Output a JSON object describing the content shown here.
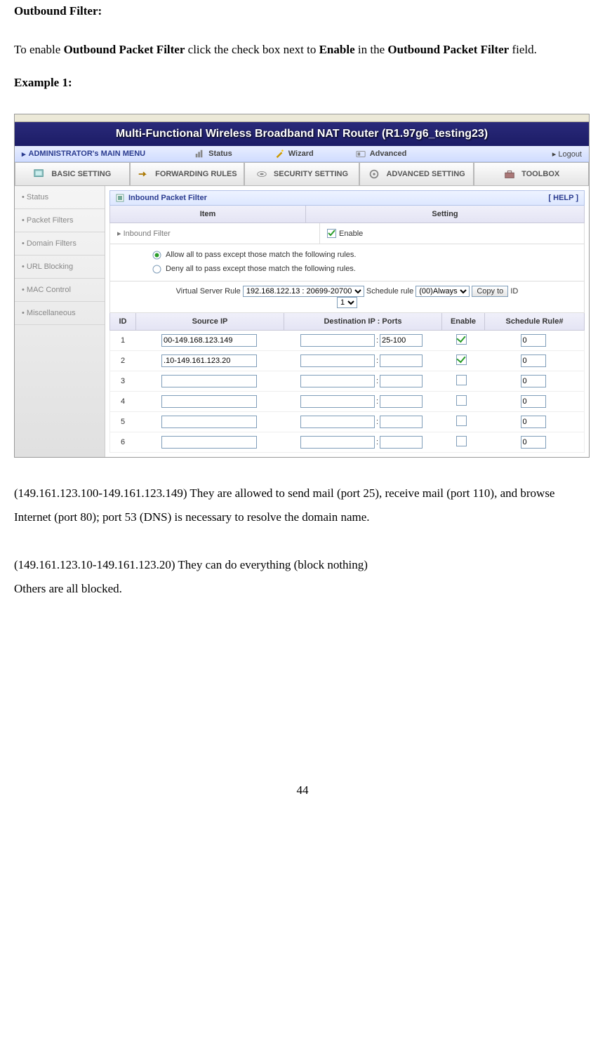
{
  "doc": {
    "heading": "Outbound Filter:",
    "body1_pre": "To enable ",
    "body1_b1": "Outbound Packet Filter",
    "body1_mid": " click the check box next to ",
    "body1_b2": "Enable",
    "body1_mid2": " in the ",
    "body1_b3": "Outbound Packet Filter",
    "body1_end": " field.",
    "example": "Example 1:",
    "para1": "(149.161.123.100-149.161.123.149) They are allowed to send mail (port 25), receive mail (port 110), and browse Internet (port 80); port 53 (DNS) is necessary to resolve the domain name.",
    "para2": "(149.161.123.10-149.161.123.20) They can do everything (block nothing)",
    "para3": "Others are all blocked.",
    "pagenum": "44"
  },
  "router": {
    "title": "Multi-Functional Wireless Broadband NAT Router (R1.97g6_testing23)",
    "admin_label": "ADMINISTRATOR's MAIN MENU",
    "nav_status": "Status",
    "nav_wizard": "Wizard",
    "nav_advanced": "Advanced",
    "logout": "Logout",
    "tabs": {
      "basic": "BASIC SETTING",
      "forwarding": "FORWARDING RULES",
      "security": "SECURITY SETTING",
      "advanced": "ADVANCED SETTING",
      "toolbox": "TOOLBOX"
    },
    "sidebar": [
      "Status",
      "Packet Filters",
      "Domain Filters",
      "URL Blocking",
      "MAC Control",
      "Miscellaneous"
    ],
    "panel_title": "Inbound Packet Filter",
    "help": "[ HELP ]",
    "col_item": "Item",
    "col_setting": "Setting",
    "inbound_filter_label": "Inbound Filter",
    "enable_label": "Enable",
    "rule_allow": "Allow all to pass except those match the following rules.",
    "rule_deny": "Deny all to pass except those match the following rules.",
    "vsrule_label": "Virtual Server Rule",
    "vsrule_value": "192.168.122.13 : 20699-20700",
    "schedule_label": "Schedule rule",
    "schedule_value": "(00)Always",
    "copyto": "Copy to",
    "id_label": "ID",
    "id_select": "1",
    "th_id": "ID",
    "th_src": "Source IP",
    "th_dest": "Destination IP : Ports",
    "th_en": "Enable",
    "th_sch": "Schedule Rule#",
    "rows": [
      {
        "id": "1",
        "src": "00-149.168.123.149",
        "dest_ip": "",
        "dest_port": "25-100",
        "en": true,
        "sch": "0"
      },
      {
        "id": "2",
        "src": ".10-149.161.123.20",
        "dest_ip": "",
        "dest_port": "",
        "en": true,
        "sch": "0"
      },
      {
        "id": "3",
        "src": "",
        "dest_ip": "",
        "dest_port": "",
        "en": false,
        "sch": "0"
      },
      {
        "id": "4",
        "src": "",
        "dest_ip": "",
        "dest_port": "",
        "en": false,
        "sch": "0"
      },
      {
        "id": "5",
        "src": "",
        "dest_ip": "",
        "dest_port": "",
        "en": false,
        "sch": "0"
      },
      {
        "id": "6",
        "src": "",
        "dest_ip": "",
        "dest_port": "",
        "en": false,
        "sch": "0"
      }
    ]
  }
}
